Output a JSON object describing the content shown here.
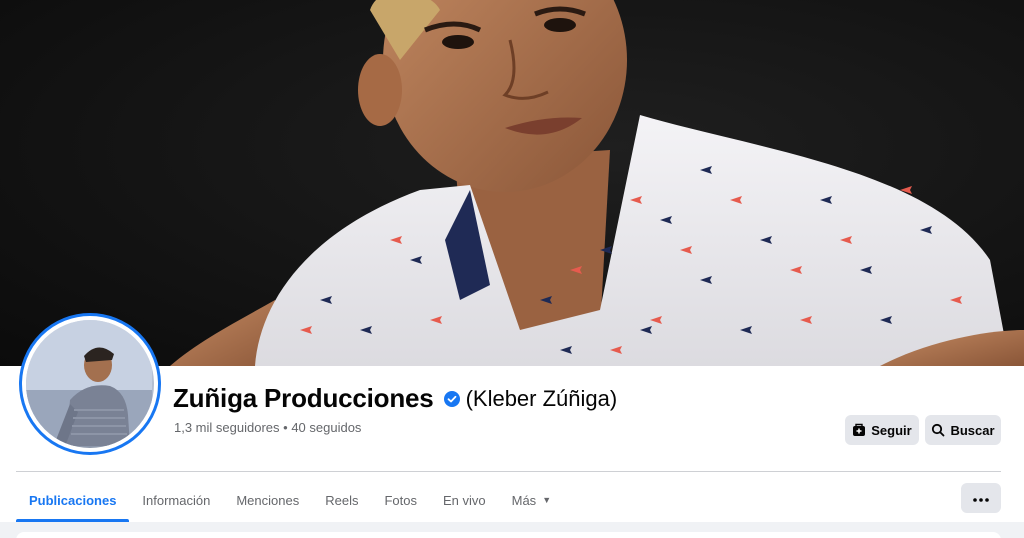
{
  "profile": {
    "page_name": "Zuñiga Producciones",
    "alt_name": "(Kleber Zúñiga)",
    "followers": "1,3 mil seguidores",
    "separator": "•",
    "following": "40 seguidos",
    "verified": true
  },
  "actions": {
    "follow_label": "Seguir",
    "search_label": "Buscar"
  },
  "tabs": [
    {
      "label": "Publicaciones",
      "active": true
    },
    {
      "label": "Información",
      "active": false
    },
    {
      "label": "Menciones",
      "active": false
    },
    {
      "label": "Reels",
      "active": false
    },
    {
      "label": "Fotos",
      "active": false
    },
    {
      "label": "En vivo",
      "active": false
    },
    {
      "label": "Más",
      "active": false,
      "dropdown": true
    }
  ],
  "icons": {
    "verified": "verified-badge-icon",
    "follow": "follow-icon",
    "search": "search-icon",
    "more": "more-options-icon",
    "dropdown": "chevron-down-icon"
  },
  "colors": {
    "accent": "#1877f2",
    "button_bg": "#e4e6eb",
    "text_primary": "#050505",
    "text_secondary": "#65676b"
  }
}
